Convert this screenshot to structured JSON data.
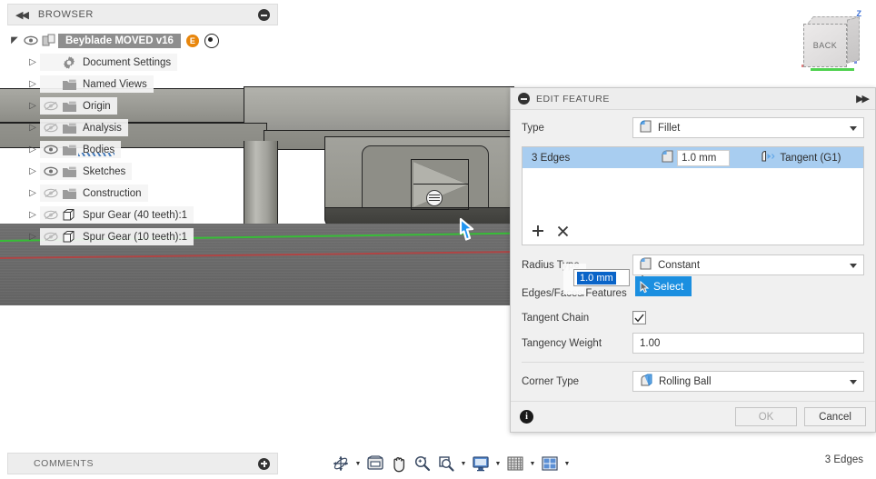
{
  "app": {
    "viewcube": {
      "face_label": "BACK",
      "axis_z_label": "Z"
    }
  },
  "browser": {
    "header": {
      "title": "BROWSER",
      "collapse_icon": "double-chevron-left-icon",
      "minimize_icon": "circle-minus-icon"
    },
    "document": {
      "name": "Beyblade MOVED v16",
      "expander": "triangle-down-icon",
      "eye": "eye-visible-icon",
      "icon": "component-icon",
      "badge": "E",
      "activate_icon": "radio-target-icon"
    },
    "items": [
      {
        "label": "Document Settings",
        "icon": "gear-icon",
        "eye": "none",
        "indent": 1,
        "hovered": false
      },
      {
        "label": "Named Views",
        "icon": "folder-icon",
        "eye": "none",
        "indent": 1,
        "hovered": false
      },
      {
        "label": "Origin",
        "icon": "folder-icon",
        "eye": "hidden",
        "indent": 1,
        "hovered": false
      },
      {
        "label": "Analysis",
        "icon": "folder-icon",
        "eye": "hidden",
        "indent": 1,
        "hovered": false
      },
      {
        "label": "Bodies",
        "icon": "folder-icon",
        "eye": "visible",
        "indent": 1,
        "hovered": true
      },
      {
        "label": "Sketches",
        "icon": "folder-icon",
        "eye": "visible",
        "indent": 1,
        "hovered": false
      },
      {
        "label": "Construction",
        "icon": "folder-icon",
        "eye": "hidden",
        "indent": 1,
        "hovered": false
      },
      {
        "label": "Spur Gear (40 teeth):1",
        "icon": "body-icon",
        "eye": "hidden",
        "indent": 1,
        "hovered": false
      },
      {
        "label": "Spur Gear (10 teeth):1",
        "icon": "body-icon",
        "eye": "hidden",
        "indent": 1,
        "hovered": false
      }
    ]
  },
  "comments": {
    "title": "COMMENTS",
    "add_icon": "circle-plus-icon"
  },
  "navbar": {
    "buttons": [
      {
        "name": "orbit-icon",
        "has_caret": true
      },
      {
        "name": "look-at-icon",
        "has_caret": false
      },
      {
        "name": "pan-hand-icon",
        "has_caret": false
      },
      {
        "name": "zoom-icon",
        "has_caret": false
      },
      {
        "name": "zoom-window-icon",
        "has_caret": true
      },
      {
        "name": "display-settings-icon",
        "has_caret": true
      },
      {
        "name": "grid-snaps-icon",
        "has_caret": true
      },
      {
        "name": "viewports-icon",
        "has_caret": true
      }
    ]
  },
  "status_bar": {
    "selection_text": "3 Edges"
  },
  "dialog": {
    "title": "EDIT FEATURE",
    "collapse_icon": "circle-minus-icon",
    "expand_icon": "double-chevron-right-icon",
    "type": {
      "label": "Type",
      "value": "Fillet",
      "icon": "fillet-icon"
    },
    "selection_list": {
      "row": {
        "name": "3 Edges",
        "radius_value": "1.0 mm",
        "radius_icon": "fillet-icon",
        "continuity": "Tangent (G1)",
        "continuity_icon": "tangent-icon"
      },
      "add_icon": "plus-icon",
      "remove_icon": "x-icon"
    },
    "radius_type": {
      "label": "Radius Type",
      "value": "Constant",
      "icon": "fillet-icon"
    },
    "edges_faces": {
      "label": "Edges/Faces/Features"
    },
    "tangent_chain": {
      "label": "Tangent Chain",
      "checked": true
    },
    "tangency_weight": {
      "label": "Tangency Weight",
      "value": "1.00"
    },
    "corner_type": {
      "label": "Corner Type",
      "value": "Rolling Ball",
      "icon": "rolling-ball-icon"
    },
    "footer": {
      "info_icon": "info-icon",
      "ok_label": "OK",
      "cancel_label": "Cancel",
      "ok_disabled": true
    }
  },
  "inline_edit": {
    "value": "1.0 mm",
    "drag_handle_icon": "vertical-dots-icon",
    "tooltip_label": "Select",
    "tooltip_icon": "cursor-select-icon",
    "tooltip_color": "#1b8fe0"
  },
  "colors": {
    "selection_blue": "#a8cdf0",
    "tooltip_blue": "#1b8fe0",
    "accent_orange": "#e8860c",
    "axis_green": "#2ecb2e",
    "axis_red": "#c03b3b"
  }
}
